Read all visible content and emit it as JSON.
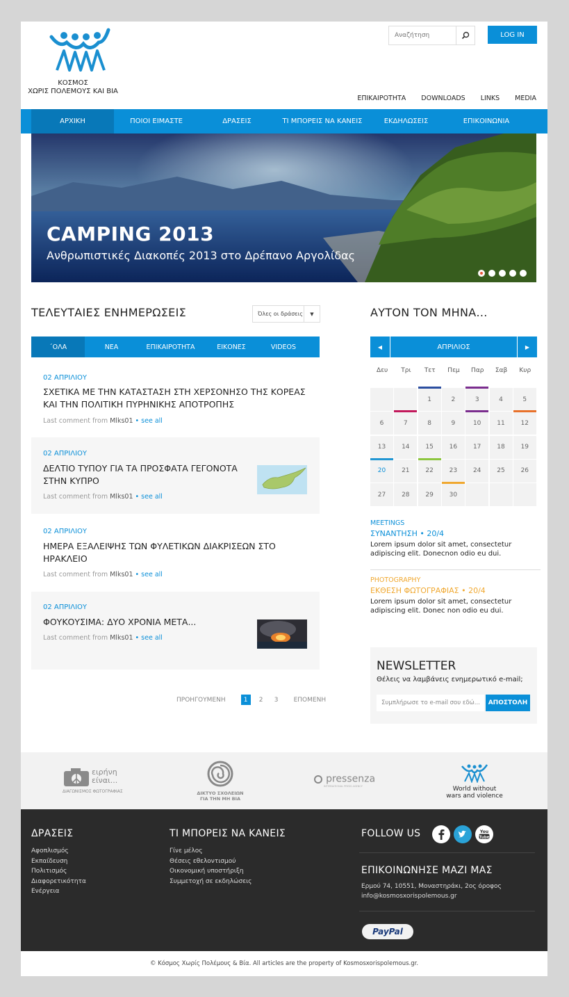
{
  "header": {
    "logo_text_line1": "ΚΟΣΜΟΣ",
    "logo_text_line2": "ΧΩΡΙΣ ΠΟΛΕΜΟΥΣ ΚΑΙ ΒΙΑ",
    "search_placeholder": "Αναζήτηση",
    "login_label": "LOG IN",
    "top_links": [
      "ΕΠΙΚΑΙΡΟΤΗΤΑ",
      "DOWNLOADS",
      "LINKS",
      "MEDIA"
    ]
  },
  "nav": {
    "items": [
      "ΑΡΧΙΚΗ",
      "ΠΟΙΟΙ ΕΙΜΑΣΤΕ",
      "ΔΡΑΣΕΙΣ",
      "ΤΙ ΜΠΟΡΕΙΣ ΝΑ ΚΑΝΕΙΣ",
      "ΕΚΔΗΛΩΣΕΙΣ",
      "ΕΠΙΚΟΙΝΩΝΙΑ"
    ]
  },
  "hero": {
    "title": "CAMPING 2013",
    "subtitle": "Ανθρωπιστικές Διακοπές 2013 στο Δρέπανο Αργολίδας"
  },
  "updates": {
    "heading": "ΤΕΛΕΥΤΑΙΕΣ ΕΝΗΜΕΡΩΣΕΙΣ",
    "filter_value": "Όλες οι δράσεις",
    "tabs": [
      "΄ΟΛΑ",
      "ΝΕΑ",
      "ΕΠΙΚΑΙΡΟΤΗΤΑ",
      "ΕΙΚΟΝΕΣ",
      "VIDEOS"
    ],
    "posts": [
      {
        "date": "02 ΑΠΡΙΛΙΟΥ",
        "title": "ΣΧΕΤΙΚΑ ΜΕ ΤΗΝ ΚΑΤΑΣΤΑΣΗ ΣΤΗ ΧΕΡΣΟΝΗΣΟ ΤΗΣ ΚΟΡΕΑΣ ΚΑΙ ΤΗΝ ΠΟΛΙΤΙΚΗ ΠΥΡΗΝΙΚΗΣ ΑΠΟΤΡΟΠΗΣ",
        "meta_prefix": "Last comment from",
        "meta_user": "Mlks01",
        "meta_link": "• see all"
      },
      {
        "date": "02 ΑΠΡΙΛΙΟΥ",
        "title": "ΔΕΛΤΙΟ ΤΥΠΟΥ ΓΙΑ ΤΑ ΠΡΟΣΦΑΤΑ ΓΕΓΟΝΟΤΑ ΣΤΗΝ ΚΥΠΡΟ",
        "meta_prefix": "Last comment from",
        "meta_user": "Mlks01",
        "meta_link": "• see all"
      },
      {
        "date": "02 ΑΠΡΙΛΙΟΥ",
        "title": "ΗΜΕΡΑ ΕΞΑΛΕΙΨΗΣ ΤΩΝ ΦΥΛΕΤΙΚΩΝ ΔΙΑΚΡΙΣΕΩΝ ΣΤΟ ΗΡΑΚΛΕΙΟ",
        "meta_prefix": "Last comment from",
        "meta_user": "Mlks01",
        "meta_link": "• see all"
      },
      {
        "date": "02 ΑΠΡΙΛΙΟΥ",
        "title": "ΦΟΥΚΟΥΣΙΜΑ: ΔΥΟ ΧΡΟΝΙΑ ΜΕΤΑ...",
        "meta_prefix": "Last comment from",
        "meta_user": "Mlks01",
        "meta_link": "• see all"
      }
    ],
    "pager": {
      "prev": "ΠΡΟΗΓΟΥΜΕΝΗ",
      "pages": [
        "1",
        "2",
        "3"
      ],
      "next": "ΕΠΟΜΕΝΗ",
      "current": "1"
    }
  },
  "calendar": {
    "heading": "ΑΥΤΟΝ ΤΟΝ ΜΗΝΑ...",
    "month": "ΑΠΡΙΛΙΟΣ",
    "weekdays": [
      "Δευ",
      "Τρι",
      "Τετ",
      "Πεμ",
      "Παρ",
      "Σαβ",
      "Κυρ"
    ],
    "days": [
      "",
      "",
      "1",
      "2",
      "3",
      "4",
      "5",
      "6",
      "7",
      "8",
      "9",
      "10",
      "11",
      "12",
      "13",
      "14",
      "15",
      "16",
      "17",
      "18",
      "19",
      "20",
      "21",
      "22",
      "23",
      "24",
      "25",
      "26",
      "27",
      "28",
      "29",
      "30",
      "",
      "",
      ""
    ],
    "today": "20",
    "marked_days": {
      "1": "#2b4ea0",
      "3": "#7b2d8e",
      "7": "#c2185b",
      "10": "#7b2d8e",
      "12": "#e8712a",
      "20": "#2196d3",
      "22": "#8dc63f",
      "30": "#f0a830"
    },
    "events": [
      {
        "category": "MEETINGS",
        "title": "ΣΥΝΑΝΤΗΣΗ • 20/4",
        "desc": "Lorem ipsum dolor sit amet, consectetur adipiscing elit. Donecnon odio eu dui.",
        "color": "#0a8fd8"
      },
      {
        "category": "PHOTOGRAPHY",
        "title": "ΕΚΘΕΣΗ ΦΩΤΟΓΡΑΦΙΑΣ • 20/4",
        "desc": "Lorem ipsum dolor sit amet, consectetur adipiscing elit. Donec non odio eu dui.",
        "color": "#f0a830"
      }
    ]
  },
  "newsletter": {
    "title": "NEWSLETTER",
    "subtitle": "Θέλεις να λαμβάνεις ενημερωτικό e-mail;",
    "placeholder": "Συμπλήρωσε το e-mail σου εδώ...",
    "button": "ΑΠΟΣΤΟΛΗ"
  },
  "partners": {
    "items": [
      {
        "name": "ειρήνη είναι...",
        "caption": "ΔΙΑΓΩΝΙΣΜΟΣ ΦΩΤΟΓΡΑΦΙΑΣ"
      },
      {
        "name": "ΔΙΚΤΥΟ ΣΧΟΛΕΙΩΝ",
        "caption": "ΓΙΑ ΤΗΝ ΜΗ ΒΙΑ"
      },
      {
        "name": "pressenza",
        "caption": "INTERNATIONAL PRESS AGENCY"
      },
      {
        "name": "World without",
        "caption": "wars and violence"
      }
    ]
  },
  "footer": {
    "col1_heading": "ΔΡΑΣΕΙΣ",
    "col1_items": [
      "Αφοπλισμός",
      "Εκπαίδευση",
      "Πολιτισμός",
      "Διαφορετικότητα",
      "Ενέργεια"
    ],
    "col2_heading": "ΤΙ ΜΠΟΡΕΙΣ ΝΑ ΚΑΝΕΙΣ",
    "col2_items": [
      "Γίνε μέλος",
      "Θέσεις εθελοντισμού",
      "Οικονομική υποστήριξη",
      "Συμμετοχή σε εκδηλώσεις"
    ],
    "follow_heading": "FOLLOW US",
    "contact_heading": "ΕΠΙΚΟΙΝΩΝΗΣΕ ΜΑΖΙ ΜΑΣ",
    "address": "Ερμού 74, 10551, Μοναστηράκι, 2ος όροφος",
    "email": "info@kosmosxorispolemous.gr",
    "paypal": "PayPal"
  },
  "copyright": "© Κόσμος Χωρίς Πολέμους & Βία. All articles are the property of Kosmosxorispolemous.gr.",
  "colors": {
    "accent": "#0a8fd8",
    "accent_dark": "#0878b8",
    "footer_bg": "#2b2b2b",
    "orange": "#f0a830",
    "active_dot": "#e8573a"
  }
}
